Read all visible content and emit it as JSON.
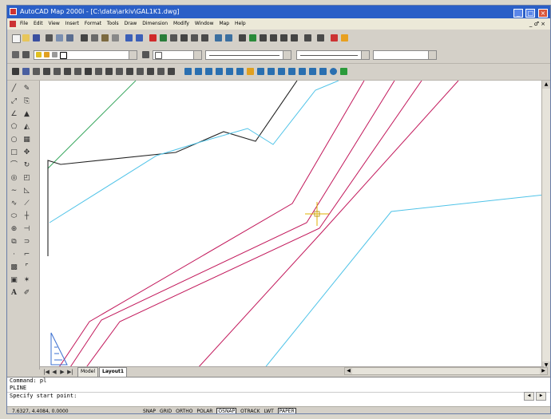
{
  "app": {
    "title": "AutoCAD Map 2000i - [C:\\data\\arkiv\\GAL1K1.dwg]",
    "window_buttons": [
      "_",
      "□",
      "×"
    ]
  },
  "menubar": {
    "items": [
      "File",
      "Edit",
      "View",
      "Insert",
      "Format",
      "Tools",
      "Draw",
      "Dimension",
      "Modify",
      "Window",
      "Map",
      "Help"
    ],
    "doc_controls": "_ ♂ ×"
  },
  "tabs": {
    "nav": [
      "|◀",
      "◀",
      "▶",
      "▶|"
    ],
    "items": [
      {
        "label": "Model",
        "active": false
      },
      {
        "label": "Layout1",
        "active": true
      }
    ]
  },
  "command": {
    "history": [
      "Command: pl",
      "PLINE"
    ],
    "prompt": "Specify start point:"
  },
  "status": {
    "coordinates": "7.6327, 4.4084, 0.0000",
    "toggles": [
      {
        "label": "SNAP",
        "on": false
      },
      {
        "label": "GRID",
        "on": false
      },
      {
        "label": "ORTHO",
        "on": false
      },
      {
        "label": "POLAR",
        "on": false
      },
      {
        "label": "OSNAP",
        "on": true
      },
      {
        "label": "OTRACK",
        "on": false
      },
      {
        "label": "LWT",
        "on": false
      },
      {
        "label": "PAPER",
        "on": true
      }
    ]
  },
  "colors": {
    "titlebar": "#2a5fc7",
    "canvas": "#ffffff",
    "line_red": "#c2185b",
    "line_cyan": "#4fc3e8",
    "line_green": "#3aa860",
    "line_black": "#222222",
    "crosshair": "#e0b000"
  },
  "icons": {
    "left_toolbar": [
      "line-icon",
      "construction-line-icon",
      "polyline-icon",
      "polygon-icon",
      "rectangle-icon",
      "arc-icon",
      "circle-icon",
      "revision-cloud-icon",
      "spline-icon",
      "ellipse-icon",
      "insert-block-icon",
      "make-block-icon",
      "point-icon",
      "hatch-icon",
      "region-icon",
      "text-icon"
    ]
  }
}
